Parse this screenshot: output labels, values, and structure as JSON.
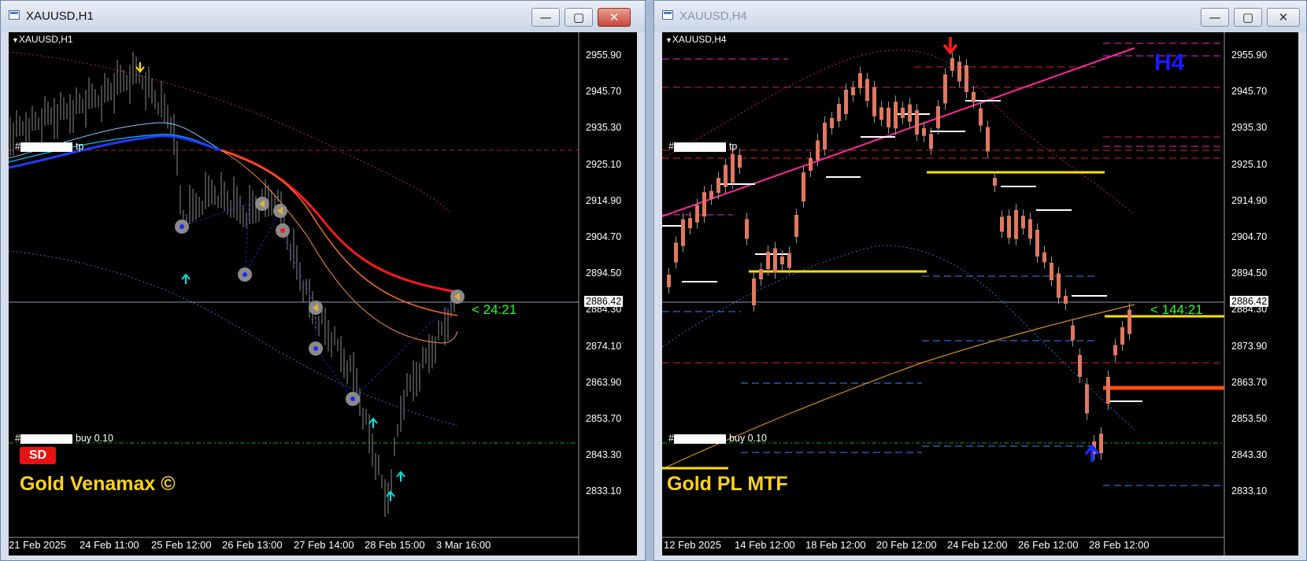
{
  "windows": [
    {
      "title": "XAUUSD,H1",
      "symbol_label": "XAUUSD,H1",
      "price_labels": [
        "2955.90",
        "2945.70",
        "2935.30",
        "2925.10",
        "2914.90",
        "2904.70",
        "2894.50",
        "2884.30",
        "2874.10",
        "2863.90",
        "2853.70",
        "2843.30",
        "2833.10"
      ],
      "current_price": "2886.42",
      "date_labels": [
        "21 Feb 2025",
        "24 Feb 11:00",
        "25 Feb 12:00",
        "26 Feb 13:00",
        "27 Feb 14:00",
        "28 Feb 15:00",
        "3 Mar 16:00"
      ],
      "timer": "< 24:21",
      "order_tp": "tp",
      "order_buy": "buy 0.10",
      "order_hash_tp": "#",
      "order_hash_buy": "#",
      "badge": "SD",
      "brand": "Gold Venamax ©"
    },
    {
      "title": "XAUUSD,H4",
      "symbol_label": "XAUUSD,H4",
      "price_labels": [
        "2955.90",
        "2945.70",
        "2935.30",
        "2925.10",
        "2914.90",
        "2904.70",
        "2894.50",
        "2884.30",
        "2873.90",
        "2863.70",
        "2853.50",
        "2843.30",
        "2833.10"
      ],
      "current_price": "2886.42",
      "date_labels": [
        "12 Feb 2025",
        "14 Feb 12:00",
        "18 Feb 12:00",
        "20 Feb 12:00",
        "24 Feb 12:00",
        "26 Feb 12:00",
        "28 Feb 12:00"
      ],
      "timer": "< 144:21",
      "order_tp": "tp",
      "order_buy": "buy 0.10",
      "order_hash_tp": "#",
      "order_hash_buy": "#",
      "tf_label": "H4",
      "brand": "Gold PL MTF"
    }
  ],
  "window_buttons": {
    "minimize": "—",
    "maximize": "▢",
    "close": "✕"
  },
  "colors": {
    "bull_candle": "#4a6fd0",
    "bear_candle": "#e07860",
    "ema_red": "#ff1a1a",
    "ema_blue": "#1f3cff",
    "pink_trend": "#ff2aa0",
    "yellow_level": "#ffe000",
    "orange_level": "#ff5010",
    "timer_green": "#26ff26",
    "brand_yellow": "#ffd21c"
  }
}
